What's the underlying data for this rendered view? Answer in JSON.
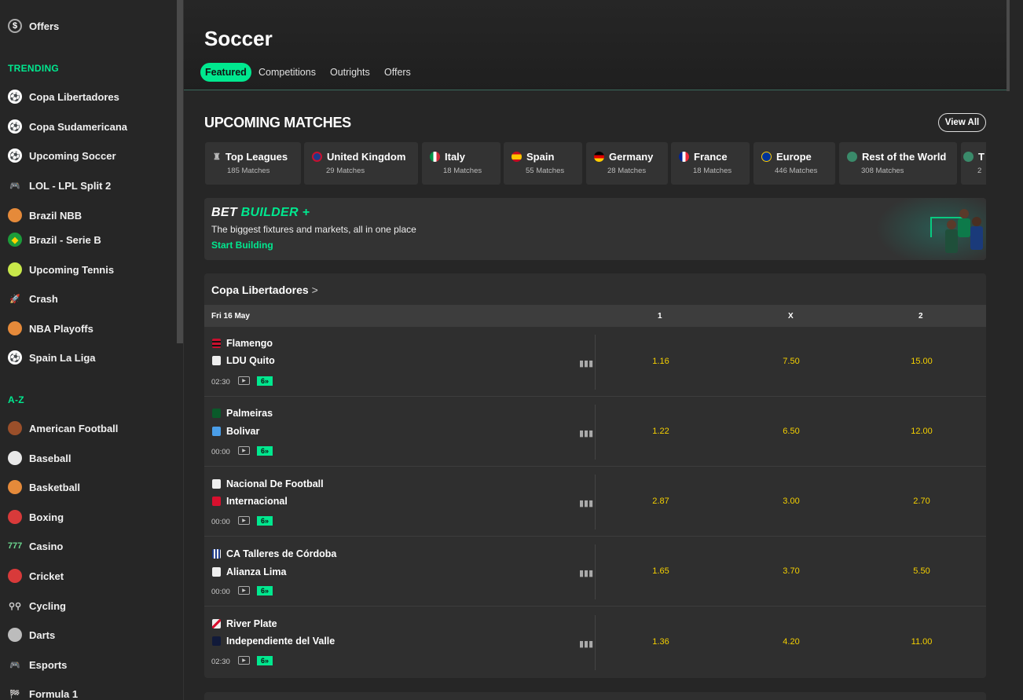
{
  "sidebar": {
    "offers": "Offers",
    "trending_label": "TRENDING",
    "trending": [
      {
        "label": "Copa Libertadores",
        "icon": "soccer-ball-icon"
      },
      {
        "label": "Copa Sudamericana",
        "icon": "soccer-ball-icon"
      },
      {
        "label": "Upcoming Soccer",
        "icon": "soccer-ball-icon"
      },
      {
        "label": "LOL - LPL Split 2",
        "icon": "gamepad-icon"
      },
      {
        "label": "Brazil NBB",
        "icon": "basketball-icon"
      },
      {
        "label": "Brazil - Serie B",
        "icon": "brazil-flag-icon"
      },
      {
        "label": "Upcoming Tennis",
        "icon": "tennis-ball-icon"
      },
      {
        "label": "Crash",
        "icon": "rocket-icon"
      },
      {
        "label": "NBA Playoffs",
        "icon": "basketball-icon"
      },
      {
        "label": "Spain La Liga",
        "icon": "soccer-ball-icon"
      }
    ],
    "az_label": "A-Z",
    "az": [
      {
        "label": "American Football",
        "icon": "american-football-icon"
      },
      {
        "label": "Baseball",
        "icon": "baseball-icon"
      },
      {
        "label": "Basketball",
        "icon": "basketball-icon"
      },
      {
        "label": "Boxing",
        "icon": "boxing-glove-icon"
      },
      {
        "label": "Casino",
        "icon": "slot-777-icon"
      },
      {
        "label": "Cricket",
        "icon": "cricket-ball-icon"
      },
      {
        "label": "Cycling",
        "icon": "bicycle-icon"
      },
      {
        "label": "Darts",
        "icon": "dartboard-icon"
      },
      {
        "label": "Esports",
        "icon": "gamepad-icon"
      },
      {
        "label": "Formula 1",
        "icon": "checkered-flag-icon"
      }
    ]
  },
  "header": {
    "title": "Soccer",
    "tabs": [
      "Featured",
      "Competitions",
      "Outrights",
      "Offers"
    ],
    "active_tab": "Featured"
  },
  "upcoming": {
    "title": "UPCOMING MATCHES",
    "view_all": "View All",
    "categories": [
      {
        "name": "Top Leagues",
        "count": "185 Matches"
      },
      {
        "name": "United Kingdom",
        "count": "29 Matches"
      },
      {
        "name": "Italy",
        "count": "18 Matches"
      },
      {
        "name": "Spain",
        "count": "55 Matches"
      },
      {
        "name": "Germany",
        "count": "28 Matches"
      },
      {
        "name": "France",
        "count": "18 Matches"
      },
      {
        "name": "Europe",
        "count": "446 Matches"
      },
      {
        "name": "Rest of the World",
        "count": "308 Matches"
      },
      {
        "name": "T",
        "count": "2"
      }
    ]
  },
  "banner": {
    "title_1": "BET ",
    "title_2": "BUILDER +",
    "subtitle": "The biggest fixtures and markets, all in one place",
    "cta": "Start Building"
  },
  "league": {
    "title": "Copa Libertadores",
    "date": "Fri 16 May",
    "col_1": "1",
    "col_x": "X",
    "col_2": "2",
    "matches": [
      {
        "home": "Flamengo",
        "away": "LDU Quito",
        "time": "02:30",
        "badge": "6",
        "odds": [
          "1.16",
          "7.50",
          "15.00"
        ]
      },
      {
        "home": "Palmeiras",
        "away": "Bolivar",
        "time": "00:00",
        "badge": "6",
        "odds": [
          "1.22",
          "6.50",
          "12.00"
        ]
      },
      {
        "home": "Nacional De Football",
        "away": "Internacional",
        "time": "00:00",
        "badge": "6",
        "odds": [
          "2.87",
          "3.00",
          "2.70"
        ]
      },
      {
        "home": "CA Talleres de Córdoba",
        "away": "Alianza Lima",
        "time": "00:00",
        "badge": "6",
        "odds": [
          "1.65",
          "3.70",
          "5.50"
        ]
      },
      {
        "home": "River Plate",
        "away": "Independiente del Valle",
        "time": "02:30",
        "badge": "6",
        "odds": [
          "1.36",
          "4.20",
          "11.00"
        ]
      }
    ]
  }
}
